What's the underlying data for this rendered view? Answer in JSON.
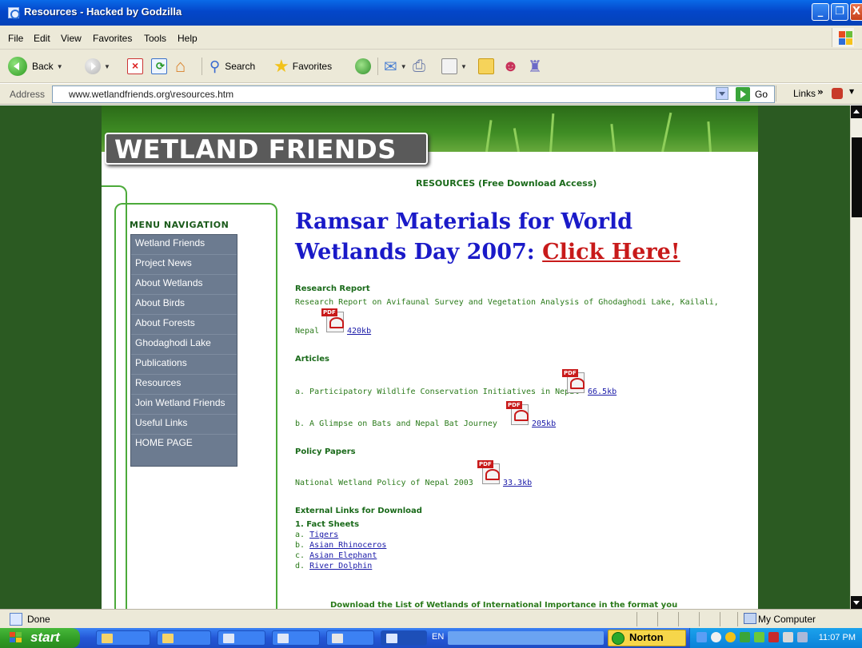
{
  "window": {
    "title": "Resources - Hacked by Godzilla",
    "controls": [
      "_",
      "❐",
      "X"
    ]
  },
  "menu": [
    "File",
    "Edit",
    "View",
    "Favorites",
    "Tools",
    "Help"
  ],
  "toolbar": {
    "back": "Back",
    "search": "Search",
    "favorites": "Favorites"
  },
  "address": {
    "label": "Address",
    "url": "www.wetlandfriends.org\\resources.htm",
    "go": "Go",
    "links": "Links",
    "links_chevron": "»"
  },
  "site": {
    "logo": "WETLAND FRIENDS",
    "resources_heading": "RESOURCES (Free Download Access)",
    "nav_title": "MENU NAVIGATION",
    "nav": [
      "Wetland Friends",
      "Project News",
      "About Wetlands",
      "About Birds",
      "About Forests",
      "Ghodaghodi Lake",
      "Publications",
      "Resources",
      "Join Wetland Friends",
      "Useful Links",
      "HOME PAGE"
    ],
    "headline_1": "Ramsar Materials for World",
    "headline_2": "Wetlands Day 2007: ",
    "headline_link": "Click Here!",
    "research": {
      "title": "Research Report",
      "line1": "Research Report on Avifaunal Survey and Vegetation Analysis of Ghodaghodi Lake, Kailali,",
      "line2": "Nepal",
      "size": "420kb"
    },
    "articles": {
      "title": "Articles",
      "a_text": "a. Participatory Wildlife Conservation Initiatives in Nepal",
      "a_size": "66.5kb",
      "b_text": "b. A Glimpse on Bats and Nepal Bat Journey",
      "b_size": "205kb"
    },
    "policy": {
      "title": "Policy Papers",
      "text": "National Wetland Policy of Nepal 2003",
      "size": "33.3kb"
    },
    "external": {
      "title": "External Links for Download",
      "fact_title": "1. Fact Sheets",
      "items": [
        {
          "prefix": "a. ",
          "label": "Tigers"
        },
        {
          "prefix": "b. ",
          "label": "Asian Rhinoceros"
        },
        {
          "prefix": "c. ",
          "label": "Asian Elephant"
        },
        {
          "prefix": "d. ",
          "label": "River Dolphin"
        }
      ]
    },
    "pdf_tag": "PDF",
    "cutoff_text": "Download the List of Wetlands of International Importance in the format you"
  },
  "status": {
    "text": "Done",
    "zone": "My Computer"
  },
  "taskbar": {
    "start": "start",
    "lang": "EN",
    "norton": "Norton",
    "clock": "11:07 PM"
  },
  "colors": {
    "page_bg": "#2b5a22",
    "nav_bg": "#6c7b90",
    "headline": "#1a1ac8",
    "headline_link": "#c81a1a",
    "green_text": "#2a7a1a"
  }
}
